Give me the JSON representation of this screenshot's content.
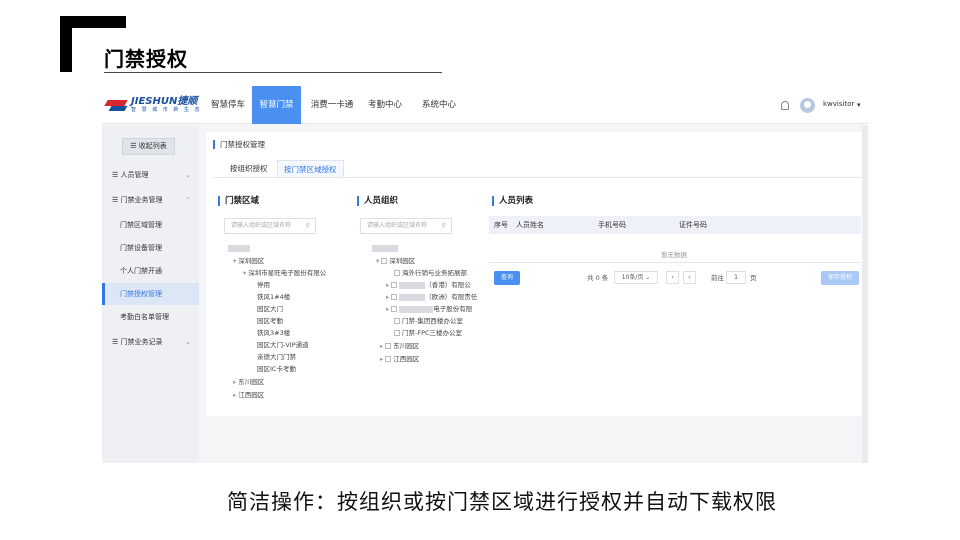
{
  "slide": {
    "title": "门禁授权",
    "caption": "简洁操作：按组织或按门禁区域进行授权并自动下载权限"
  },
  "app": {
    "logo_name": "JIESHUN捷顺",
    "logo_sub": "智 慧 城 市 新 生 态",
    "nav": [
      "智慧停车",
      "智慧门禁",
      "消费一卡通",
      "考勤中心",
      "系统中心"
    ],
    "active_nav": "智慧门禁",
    "username": "kwvisitor"
  },
  "sidebar": {
    "collapse_label": "收起列表",
    "items": [
      {
        "label": "人员管理",
        "chev": "⌄"
      },
      {
        "label": "门禁业务管理",
        "chev": "⌃"
      },
      {
        "label": "门禁区域管理"
      },
      {
        "label": "门禁设备管理"
      },
      {
        "label": "个人门禁开通"
      },
      {
        "label": "门禁授权管理"
      },
      {
        "label": "考勤白名单管理"
      },
      {
        "label": "门禁业务记录",
        "chev": "⌄"
      }
    ]
  },
  "main": {
    "breadcrumb": "门禁授权管理",
    "tabs": [
      "按组织授权",
      "按门禁区域授权"
    ],
    "area": {
      "title": "门禁区域",
      "search_placeholder": "请输入组织或区域名称",
      "tree": [
        "深圳园区",
        "深圳市星旺电子股份有限公",
        "停用",
        "铁风1#4楼",
        "园区大门",
        "园区考勤",
        "铁风3#3楼",
        "园区大门-VIP通道",
        "亲德大门门禁",
        "园区IC卡考勤",
        "东川园区",
        "江西园区"
      ]
    },
    "org": {
      "title": "人员组织",
      "search_placeholder": "请输入组织或区域名称",
      "tree": [
        "深圳园区",
        "海外行销与业务拓展部",
        "（香港）有限公",
        "（欧洲）有限责任",
        "电子股份有限",
        "门禁-集团西楼办公室",
        "门禁-FPC三楼办公室",
        "东川园区",
        "江西园区"
      ]
    },
    "people": {
      "title": "人员列表",
      "columns": [
        "序号",
        "人员姓名",
        "手机号码",
        "证件号码"
      ],
      "empty_text": "暂无数据",
      "query_label": "查询",
      "total_text": "共 0 条",
      "page_size": "10条/页",
      "goto_label": "前往",
      "page_num": "1",
      "page_unit": "页",
      "save_label": "保存授权"
    }
  }
}
